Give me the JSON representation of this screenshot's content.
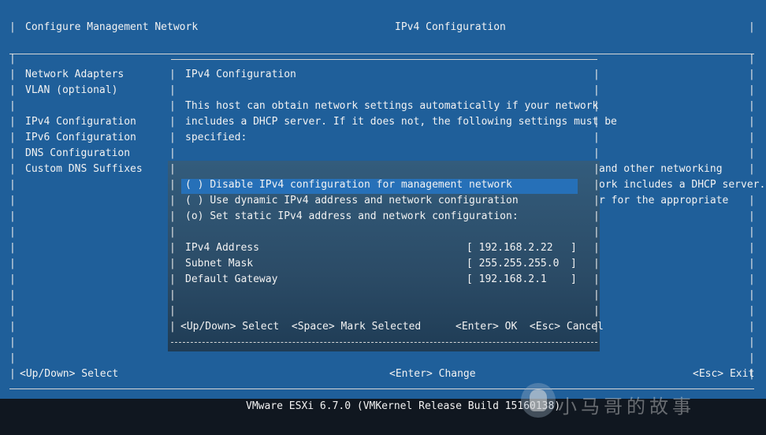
{
  "header": {
    "left_title": "Configure Management Network",
    "right_title": "IPv4 Configuration"
  },
  "menu": {
    "items": [
      "Network Adapters",
      "VLAN (optional)",
      "IPv4 Configuration",
      "IPv6 Configuration",
      "DNS Configuration",
      "Custom DNS Suffixes"
    ]
  },
  "background_text": {
    "line1": "and other networking",
    "line2": "ork includes a DHCP server.",
    "line3": "r for the appropriate"
  },
  "dialog": {
    "title": "IPv4 Configuration",
    "desc1": "This host can obtain network settings automatically if your network",
    "desc2": "includes a DHCP server. If it does not, the following settings must be",
    "desc3": "specified:",
    "options": [
      {
        "mark": "( )",
        "label": "Disable IPv4 configuration for management network",
        "selected": false,
        "focused": true
      },
      {
        "mark": "( )",
        "label": "Use dynamic IPv4 address and network configuration",
        "selected": false,
        "focused": false
      },
      {
        "mark": "(o)",
        "label": "Set static IPv4 address and network configuration:",
        "selected": true,
        "focused": false
      }
    ],
    "fields": [
      {
        "label": "IPv4 Address",
        "value": "192.168.2.22"
      },
      {
        "label": "Subnet Mask",
        "value": "255.255.255.0"
      },
      {
        "label": "Default Gateway",
        "value": "192.168.2.1"
      }
    ],
    "footer_left": "<Up/Down> Select  <Space> Mark Selected",
    "footer_right": "<Enter> OK  <Esc> Cancel"
  },
  "footer": {
    "left": "<Up/Down> Select",
    "center": "<Enter> Change",
    "right": "<Esc> Exit"
  },
  "status_bar": "VMware ESXi 6.7.0 (VMKernel Release Build 15160138)",
  "watermark": "小马哥的故事",
  "colors": {
    "background": "#1f5f9a",
    "highlight": "#2670b8",
    "text": "#f2f2f2",
    "status_bar": "#101720"
  }
}
